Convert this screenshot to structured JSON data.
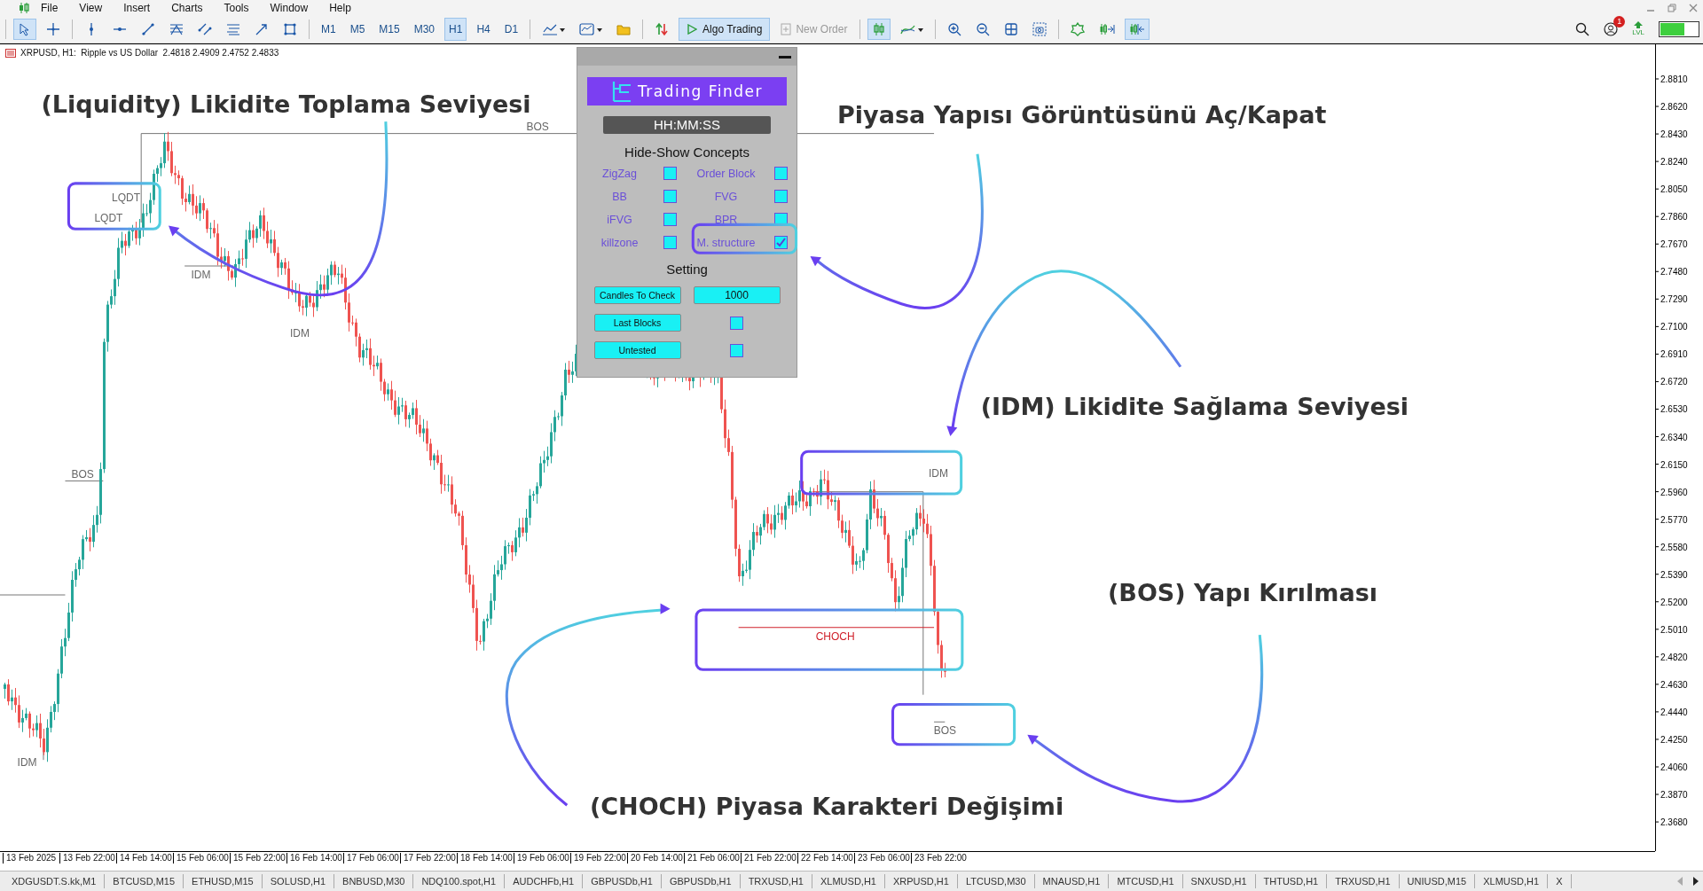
{
  "menu": [
    "File",
    "View",
    "Insert",
    "Charts",
    "Tools",
    "Window",
    "Help"
  ],
  "toolbar": {
    "timeframes": [
      {
        "label": "M1",
        "selected": false
      },
      {
        "label": "M5",
        "selected": false
      },
      {
        "label": "M15",
        "selected": false
      },
      {
        "label": "M30",
        "selected": false
      },
      {
        "label": "H1",
        "selected": true
      },
      {
        "label": "H4",
        "selected": false
      },
      {
        "label": "D1",
        "selected": false
      }
    ],
    "algo_trading": {
      "label": "Algo Trading",
      "on": true
    },
    "new_order": {
      "label": "New Order",
      "disabled": true
    },
    "notification_count": "1",
    "level_label": "LVL"
  },
  "chart": {
    "title": "XRPUSD, H1:  Ripple vs US Dollar  2.4818 2.4909 2.4752 2.4833",
    "price_ticks": [
      "2.8810",
      "2.8620",
      "2.8430",
      "2.8240",
      "2.8050",
      "2.7860",
      "2.7670",
      "2.7480",
      "2.7290",
      "2.7100",
      "2.6910",
      "2.6720",
      "2.6530",
      "2.6340",
      "2.6150",
      "2.5960",
      "2.5770",
      "2.5580",
      "2.5390",
      "2.5200",
      "2.5010",
      "2.4820",
      "2.4630",
      "2.4440",
      "2.4250",
      "2.4060",
      "2.3870",
      "2.3680"
    ],
    "time_ticks": [
      "13 Feb 2025",
      "13 Feb 22:00",
      "14 Feb 14:00",
      "15 Feb 06:00",
      "15 Feb 22:00",
      "16 Feb 14:00",
      "17 Feb 06:00",
      "17 Feb 22:00",
      "18 Feb 14:00",
      "19 Feb 06:00",
      "19 Feb 22:00",
      "20 Feb 14:00",
      "21 Feb 06:00",
      "21 Feb 22:00",
      "22 Feb 14:00",
      "23 Feb 06:00",
      "23 Feb 22:00"
    ],
    "labels": [
      {
        "text": "BOS",
        "kind": "structure"
      },
      {
        "text": "LQDT",
        "kind": "structure"
      },
      {
        "text": "LQDT",
        "kind": "structure"
      },
      {
        "text": "IDM",
        "kind": "structure"
      },
      {
        "text": "IDM",
        "kind": "structure"
      },
      {
        "text": "BOS",
        "kind": "structure"
      },
      {
        "text": "IDM",
        "kind": "structure"
      },
      {
        "text": "IDM",
        "kind": "structure"
      },
      {
        "text": "CHOCH",
        "kind": "change"
      },
      {
        "text": "BOS",
        "kind": "structure"
      }
    ]
  },
  "panel": {
    "logo": "Trading Finder",
    "clock": "HH:MM:SS",
    "concepts_title": "Hide-Show Concepts",
    "concepts": [
      {
        "label": "ZigZag",
        "checked": false
      },
      {
        "label": "Order Block",
        "checked": false
      },
      {
        "label": "BB",
        "checked": false
      },
      {
        "label": "FVG",
        "checked": false
      },
      {
        "label": "iFVG",
        "checked": false
      },
      {
        "label": "BPR",
        "checked": false
      },
      {
        "label": "killzone",
        "checked": false
      },
      {
        "label": "M. structure",
        "checked": true
      }
    ],
    "setting_title": "Setting",
    "settings": [
      {
        "label": "Candles To Check",
        "kind": "value",
        "value": "1000"
      },
      {
        "label": "Last Blocks",
        "kind": "toggle",
        "checked": false
      },
      {
        "label": "Untested",
        "kind": "toggle",
        "checked": false
      }
    ]
  },
  "callouts": [
    "(Liquidity) Likidite Toplama Seviyesi",
    "Piyasa Yapısı Görüntüsünü Aç/Kapat",
    "(IDM) Likidite Sağlama Seviyesi",
    "(BOS) Yapı Kırılması",
    "(CHOCH) Piyasa Karakteri Değişimi"
  ],
  "tabs": [
    "XDGUSDT.S.kk,M1",
    "BTCUSD,M15",
    "ETHUSD,M15",
    "SOLUSD,H1",
    "BNBUSD,M30",
    "NDQ100.spot,H1",
    "AUDCHFb,H1",
    "GBPUSDb,H1",
    "GBPUSDb,H1",
    "TRXUSD,H1",
    "XLMUSD,H1",
    "XRPUSD,H1",
    "LTCUSD,M30",
    "MNAUSD,H1",
    "MTCUSD,H1",
    "SNXUSD,H1",
    "THTUSD,H1",
    "TRXUSD,H1",
    "UNIUSD,M15",
    "XLMUSD,H1",
    "X"
  ]
}
